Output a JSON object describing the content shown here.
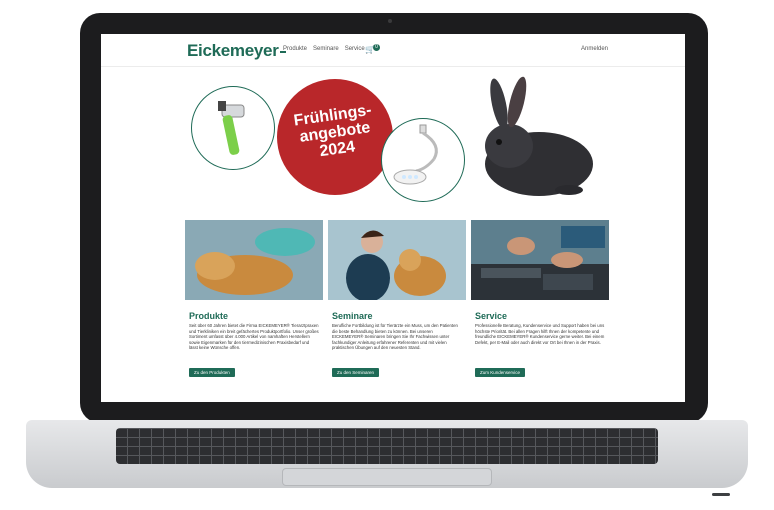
{
  "header": {
    "logo": "Eickemeyer",
    "nav": [
      "Produkte",
      "Seminare",
      "Service"
    ],
    "cart_count": "0",
    "login": "Anmelden"
  },
  "hero": {
    "line1": "Frühlings-",
    "line2": "angebote",
    "line3": "2024"
  },
  "cards": [
    {
      "title": "Produkte",
      "text": "Seit über 60 Jahren bietet die Firma EICKEMEYER® Tierarztpraxen und Tierkliniken ein breit gefächertes Produktportfolio. Unser großes Sortiment umfasst über 4.000 Artikel von namhaften Herstellern sowie Eigenmarken für den tiermedizinischen Praxisbedarf und lässt keine Wünsche offen.",
      "button": "Zu den Produkten"
    },
    {
      "title": "Seminare",
      "text": "Berufliche Fortbildung ist für Tierärzte ein Muss, um den Patienten die beste Behandlung bieten zu können. Bei unseren EICKEMEYER® Seminaren bringen Sie Ihr Fachwissen unter fachkundiger Anleitung erfahrener Referenten und mit vielen praktischen Übungen auf den neuesten Stand.",
      "button": "Zu den Seminaren"
    },
    {
      "title": "Service",
      "text": "Professionelle Beratung, Kundenservice und Support haben bei uns höchste Priorität. Bei allen Fragen hilft Ihnen der kompetente und freundliche EICKEMEYER® Kundenservice gerne weiter. Bei einem Defekt, per E-Mail oder auch direkt vor Ort bei Ihnen in der Praxis.",
      "button": "Zum Kundenservice"
    }
  ],
  "colors": {
    "brand": "#1f6b57",
    "hero_red": "#b9272a"
  }
}
